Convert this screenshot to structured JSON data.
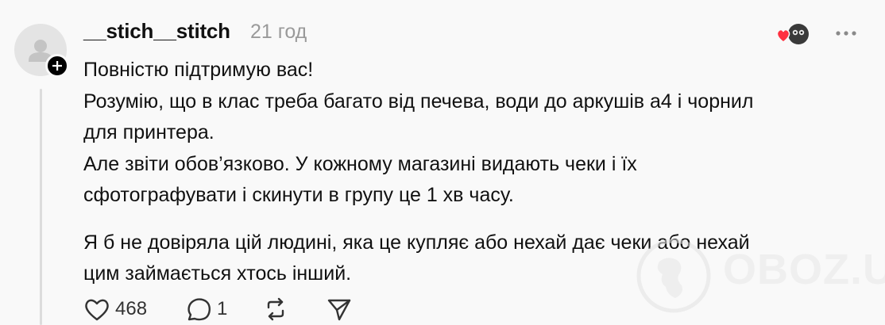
{
  "post": {
    "username": "__stich__stitch",
    "timestamp": "21 год",
    "paragraphs": [
      {
        "lines": [
          "Повністю підтримую вас!",
          "Розумію, що в клас треба багато від печева, води до аркушів а4 і чорнил",
          "для принтера.",
          "Але звіти обов’язково. У кожному магазині видають чеки і їх",
          "сфотографувати і скинути в групу це 1 хв часу."
        ]
      },
      {
        "lines": [
          "Я б не довіряла цій людині, яка це купляє або нехай дає чеки або нехай",
          "цим займається хтось інший."
        ]
      }
    ],
    "actions": {
      "likes": "468",
      "replies": "1"
    }
  },
  "watermark": {
    "text": "OBOZ.UA"
  },
  "icons": {
    "like": "heart-outline-icon",
    "reply": "speech-bubble-icon",
    "repost": "repost-icon",
    "share": "send-icon",
    "more": "more-dots-icon",
    "follow": "plus-icon",
    "avatar": "default-user-icon"
  },
  "colors": {
    "background": "#f9f9f9",
    "text": "#111111",
    "muted": "#9a9a9a",
    "heart": "#ff3040"
  }
}
